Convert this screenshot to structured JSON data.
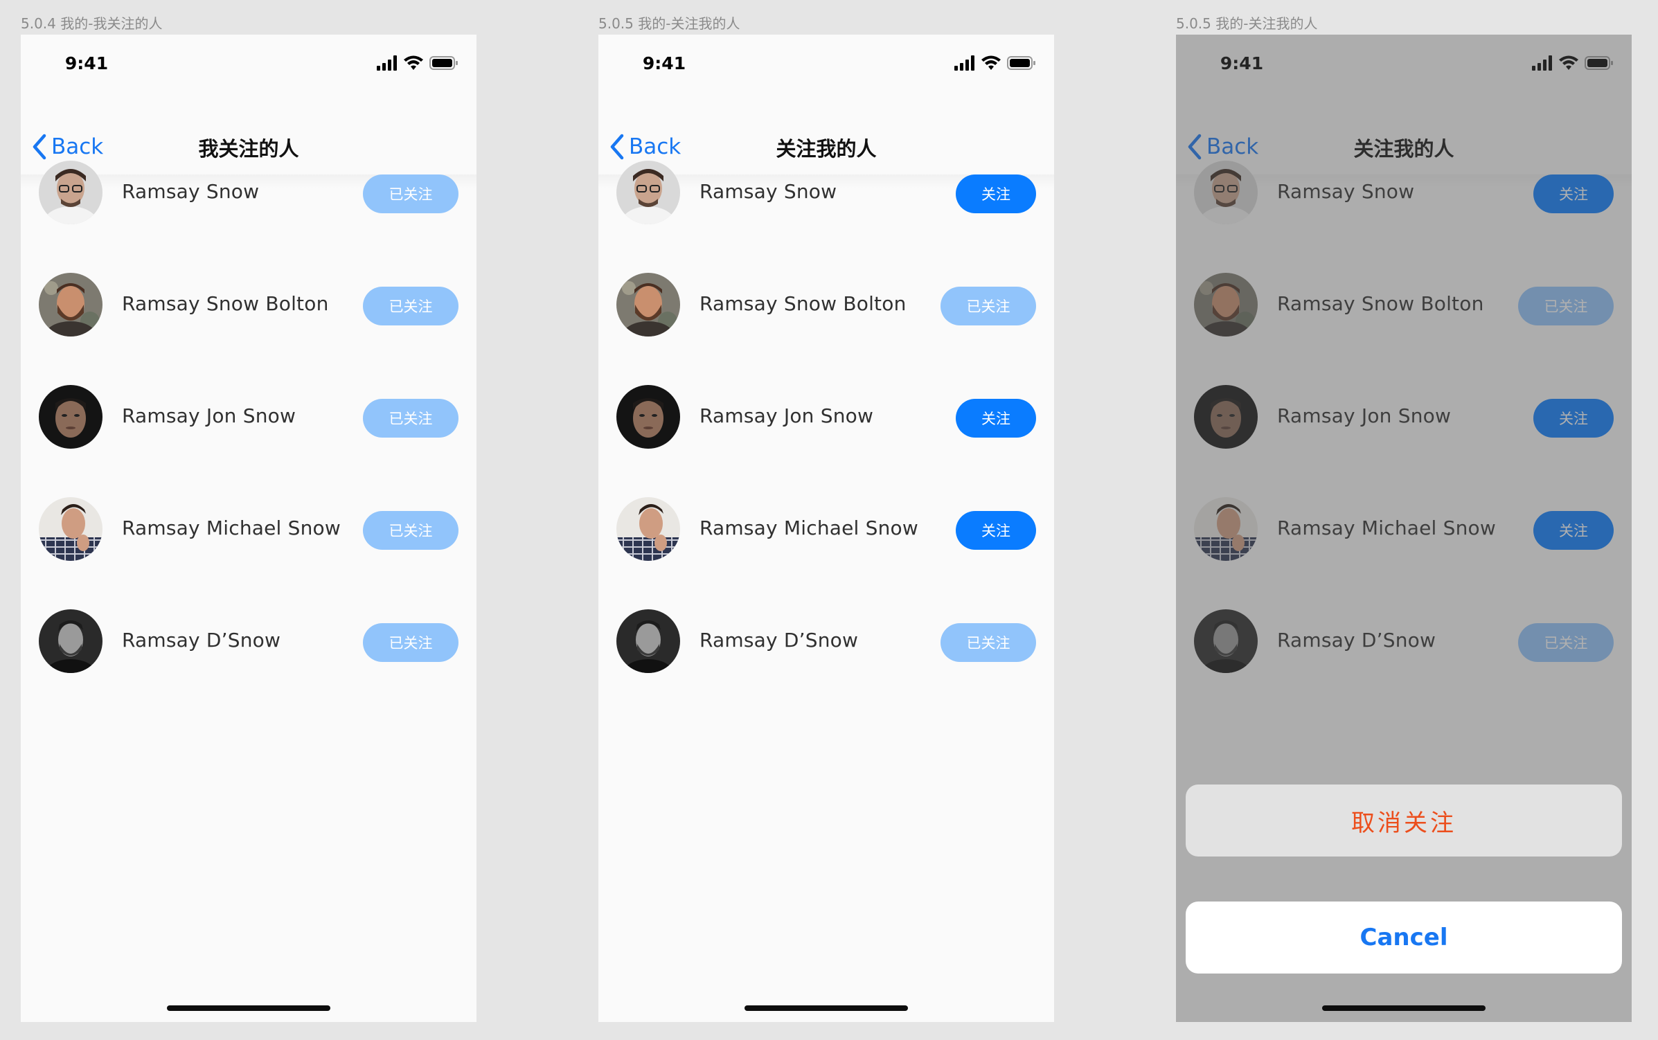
{
  "frames": [
    {
      "caption": "5.0.4 我的-我关注的人",
      "status_time": "9:41",
      "back_label": "Back",
      "title": "我关注的人",
      "rows": [
        {
          "name": "Ramsay Snow",
          "button": "已关注",
          "state": "followed",
          "avatar": "glasses"
        },
        {
          "name": "Ramsay Snow Bolton",
          "button": "已关注",
          "state": "followed",
          "avatar": "beard"
        },
        {
          "name": "Ramsay Jon Snow",
          "button": "已关注",
          "state": "followed",
          "avatar": "dark"
        },
        {
          "name": "Ramsay Michael Snow",
          "button": "已关注",
          "state": "followed",
          "avatar": "plaid"
        },
        {
          "name": "Ramsay D’Snow",
          "button": "已关注",
          "state": "followed",
          "avatar": "bw"
        }
      ]
    },
    {
      "caption": "5.0.5 我的-关注我的人",
      "status_time": "9:41",
      "back_label": "Back",
      "title": "关注我的人",
      "rows": [
        {
          "name": "Ramsay Snow",
          "button": "关注",
          "state": "follow",
          "avatar": "glasses"
        },
        {
          "name": "Ramsay Snow Bolton",
          "button": "已关注",
          "state": "followed",
          "avatar": "beard"
        },
        {
          "name": "Ramsay Jon Snow",
          "button": "关注",
          "state": "follow",
          "avatar": "dark"
        },
        {
          "name": "Ramsay Michael Snow",
          "button": "关注",
          "state": "follow",
          "avatar": "plaid"
        },
        {
          "name": "Ramsay D’Snow",
          "button": "已关注",
          "state": "followed",
          "avatar": "bw"
        }
      ]
    },
    {
      "caption": "5.0.5 我的-关注我的人",
      "status_time": "9:41",
      "back_label": "Back",
      "title": "关注我的人",
      "rows": [
        {
          "name": "Ramsay Snow",
          "button": "关注",
          "state": "follow",
          "avatar": "glasses"
        },
        {
          "name": "Ramsay Snow Bolton",
          "button": "已关注",
          "state": "followed",
          "avatar": "beard"
        },
        {
          "name": "Ramsay Jon Snow",
          "button": "关注",
          "state": "follow",
          "avatar": "dark"
        },
        {
          "name": "Ramsay Michael Snow",
          "button": "关注",
          "state": "follow",
          "avatar": "plaid"
        },
        {
          "name": "Ramsay D’Snow",
          "button": "已关注",
          "state": "followed",
          "avatar": "bw"
        }
      ],
      "action_sheet": {
        "unfollow_label": "取消关注",
        "cancel_label": "Cancel"
      }
    }
  ],
  "colors": {
    "accent": "#0a7cff",
    "followed_button": "#91c4fb",
    "destructive": "#ec4e1c",
    "back_blue": "#1877f2"
  },
  "icons": {
    "back": "chevron-left-icon",
    "signal": "cellular-signal-icon",
    "wifi": "wifi-icon",
    "battery": "battery-icon"
  }
}
